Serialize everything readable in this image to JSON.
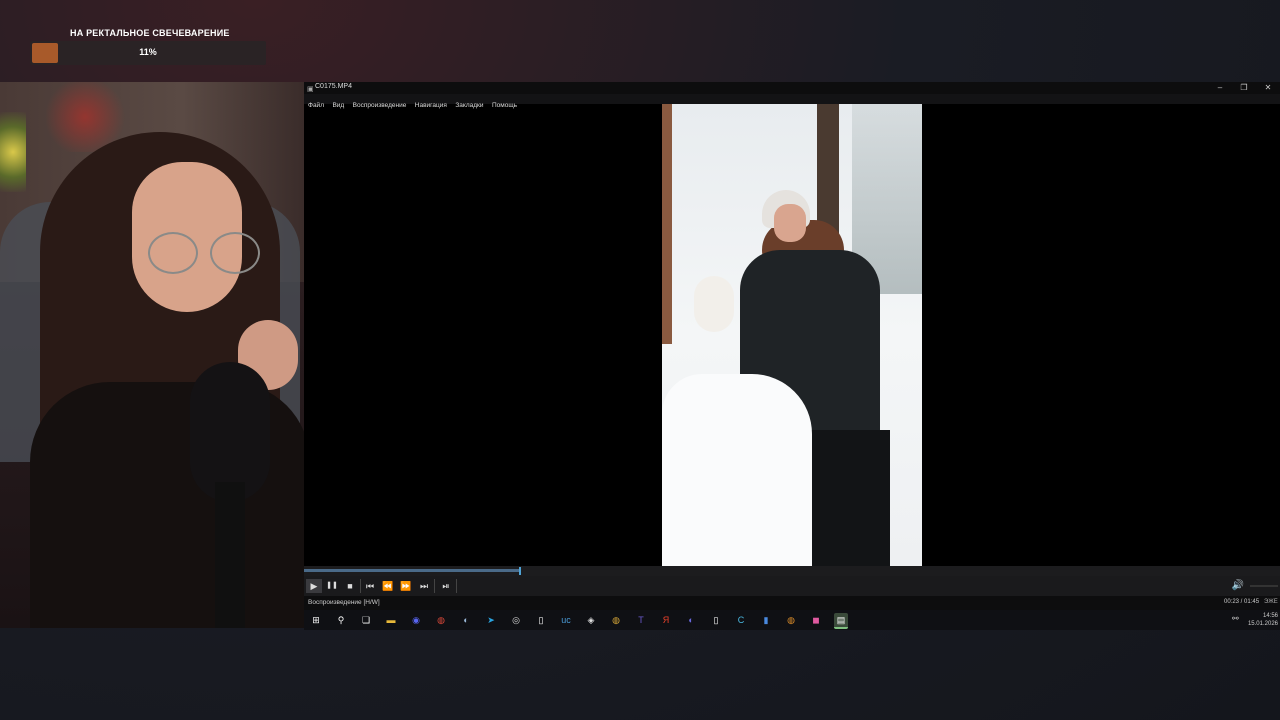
{
  "goal": {
    "title": "НА РЕКТАЛЬНОЕ СВЕЧЕВАРЕНИЕ",
    "percent_text": "11%",
    "progress": 0.11,
    "fill_color": "#a85a2a"
  },
  "webcam": {
    "icon": "webcam-feed"
  },
  "player": {
    "window_title": "C0175.MP4",
    "window_buttons": {
      "minimize": "–",
      "restore": "❐",
      "close": "✕"
    },
    "menu": [
      "Файл",
      "Вид",
      "Воспроизведение",
      "Навигация",
      "Закладки",
      "Помощь"
    ],
    "video_frame": {
      "description_icon": "snowy-forest-video-frame"
    },
    "seek_progress": 0.22,
    "controls": {
      "play": "▶",
      "pause": "❚❚",
      "stop": "■",
      "prev": "⏮",
      "rewind": "⏪",
      "forward": "⏩",
      "next": "⏭",
      "frame_step": "⏯",
      "volume": "🔊"
    },
    "status": {
      "text": "Воспроизведение [H/W]",
      "time": "00:23 / 01:45",
      "flag": "ЭЖЕ"
    },
    "accent_color": "#4fa3d6"
  },
  "taskbar": {
    "icons": [
      {
        "name": "windows-start-icon",
        "glyph": "⊞",
        "color": "#ffffff"
      },
      {
        "name": "search-icon",
        "glyph": "⚲",
        "color": "#ffffff"
      },
      {
        "name": "task-view-icon",
        "glyph": "❏",
        "color": "#ffffff"
      },
      {
        "name": "file-explorer-icon",
        "glyph": "▬",
        "color": "#e8b93a"
      },
      {
        "name": "discord-icon",
        "glyph": "◉",
        "color": "#5865f2"
      },
      {
        "name": "chrome-icon",
        "glyph": "◍",
        "color": "#e04a3a"
      },
      {
        "name": "steam-icon",
        "glyph": "◐",
        "color": "#9ab8d8"
      },
      {
        "name": "telegram-icon",
        "glyph": "➤",
        "color": "#2aa3de"
      },
      {
        "name": "obs-icon",
        "glyph": "◎",
        "color": "#dddddd"
      },
      {
        "name": "document-icon",
        "glyph": "▯",
        "color": "#ffffff"
      },
      {
        "name": "uc-icon",
        "glyph": "uc",
        "color": "#4a9ad6"
      },
      {
        "name": "app-icon-1",
        "glyph": "◈",
        "color": "#e0e0e0"
      },
      {
        "name": "app-icon-2",
        "glyph": "◍",
        "color": "#d8a838"
      },
      {
        "name": "t-app-icon",
        "glyph": "T",
        "color": "#6a5acd"
      },
      {
        "name": "yandex-icon",
        "glyph": "Я",
        "color": "#e8402a"
      },
      {
        "name": "app-icon-3",
        "glyph": "◐",
        "color": "#6a6ae0"
      },
      {
        "name": "document-icon-2",
        "glyph": "▯",
        "color": "#ffffff"
      },
      {
        "name": "c-app-icon",
        "glyph": "C",
        "color": "#4ab8e0"
      },
      {
        "name": "stats-icon",
        "glyph": "▮",
        "color": "#4a8ae0"
      },
      {
        "name": "app-icon-4",
        "glyph": "◍",
        "color": "#e0902a"
      },
      {
        "name": "app-icon-5",
        "glyph": "◼",
        "color": "#e05aa0"
      },
      {
        "name": "media-player-icon",
        "glyph": "▤",
        "color": "#ffffff"
      }
    ],
    "clock": {
      "time": "14:56",
      "date": "15.01.2026"
    },
    "tray_icon": "network-icon"
  }
}
